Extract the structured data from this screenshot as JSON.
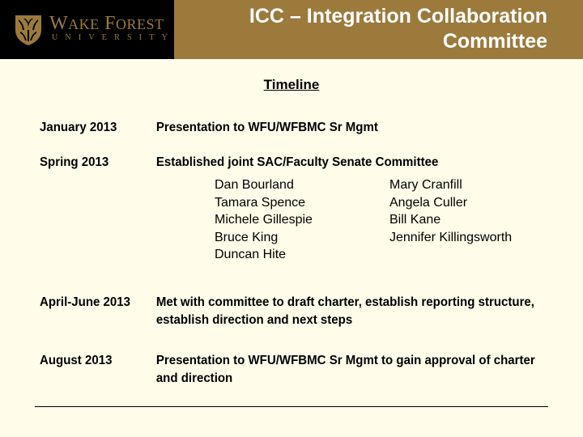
{
  "header": {
    "logo": {
      "wordmark": "Wake Forest",
      "subtext": "UNIVERSITY",
      "icon": "shield-icon"
    },
    "title_line1": "ICC – Integration Collaboration",
    "title_line2": "Committee",
    "colors": {
      "gold": "#9C7A3C",
      "logo_background": "#000000",
      "title_text": "#FFFFFF",
      "page_background": "#FFFCE9"
    }
  },
  "subtitle": "Timeline",
  "timeline": [
    {
      "date": "January 2013",
      "description": "Presentation to WFU/WFBMC Sr Mgmt"
    },
    {
      "date": "Spring 2013",
      "description": "Established joint SAC/Faculty Senate Committee"
    },
    {
      "date": "April-June 2013",
      "description": "Met with committee to draft charter, establish reporting structure, establish direction and next steps"
    },
    {
      "date": "August 2013",
      "description": "Presentation to WFU/WFBMC Sr Mgmt to gain approval of charter and direction"
    }
  ],
  "committee_members": {
    "column1": [
      "Dan Bourland",
      "Tamara Spence",
      "Michele Gillespie",
      "Bruce King",
      "Duncan Hite"
    ],
    "column2": [
      "Mary Cranfill",
      "Angela Culler",
      "Bill Kane",
      "Jennifer Killingsworth"
    ]
  }
}
